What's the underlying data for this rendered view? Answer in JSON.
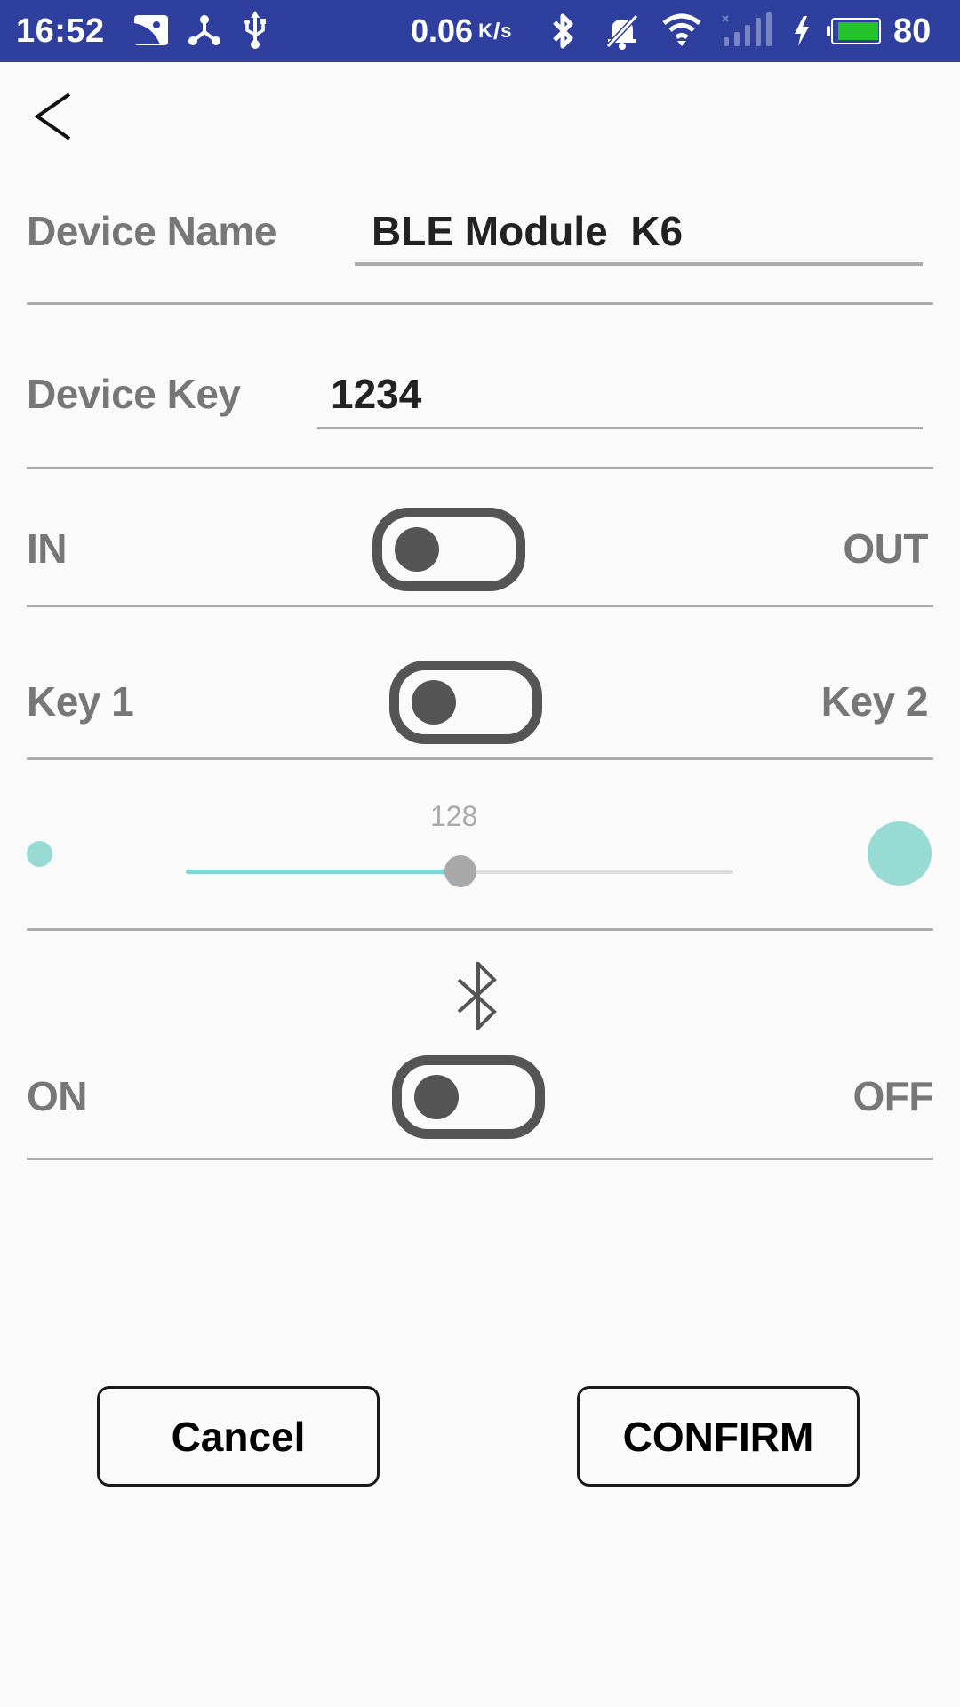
{
  "status_bar": {
    "time": "16:52",
    "icons_left": [
      "gallery-icon",
      "share-hub-icon",
      "usb-icon"
    ],
    "net_speed_value": "0.06",
    "net_speed_unit_top": "K",
    "net_speed_unit_bottom": "s",
    "icons_right": [
      "bluetooth-icon",
      "bell-off-icon",
      "wifi-icon",
      "cellular-no-signal-icon",
      "charging-icon",
      "battery-icon"
    ],
    "battery_percent": "80",
    "battery_level": 0.8,
    "colors": {
      "background": "#2f3f9e",
      "battery_fill": "#22c42a"
    }
  },
  "header": {
    "back_icon": "chevron-left-icon"
  },
  "form": {
    "device_name": {
      "label": "Device Name",
      "value": "BLE Module  K6"
    },
    "device_key": {
      "label": "Device Key",
      "value": "1234"
    },
    "direction_toggle": {
      "left_label": "IN",
      "right_label": "OUT",
      "state": "IN"
    },
    "key_toggle": {
      "left_label": "Key 1",
      "right_label": "Key 2",
      "state": "Key 1"
    },
    "slider": {
      "value_label": "128",
      "value": 128,
      "min": 0,
      "max": 255,
      "accent": "#7fd6d2"
    },
    "bluetooth": {
      "icon": "bluetooth-icon",
      "left_label": "ON",
      "right_label": "OFF",
      "state": "ON"
    }
  },
  "actions": {
    "cancel_label": "Cancel",
    "confirm_label": "CONFIRM"
  }
}
